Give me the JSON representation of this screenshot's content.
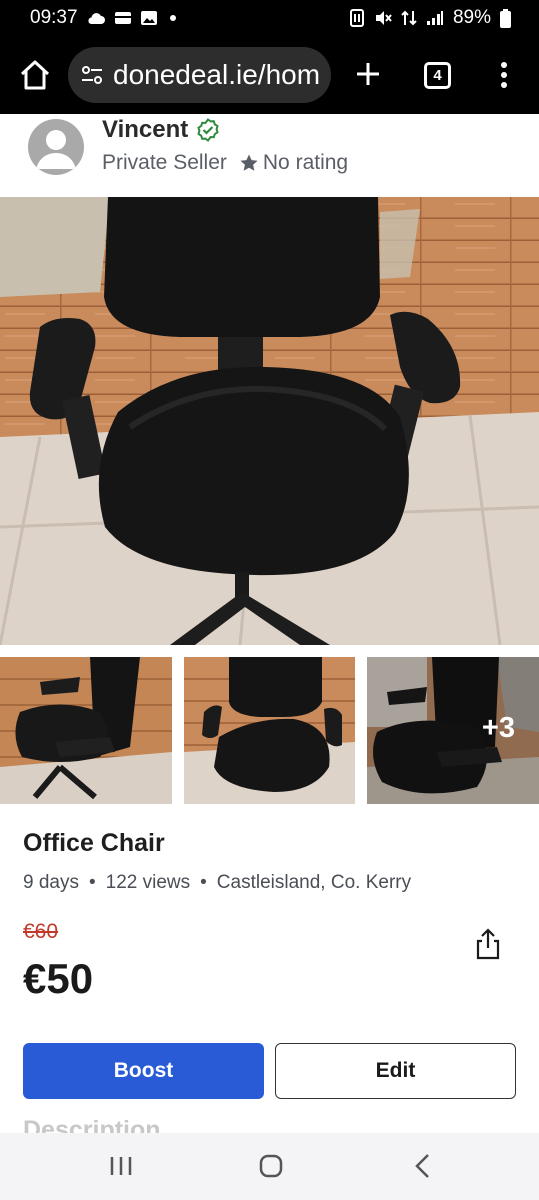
{
  "status_bar": {
    "time": "09:37",
    "battery": "89%"
  },
  "browser": {
    "url": "donedeal.ie/hom",
    "tab_count": "4"
  },
  "seller": {
    "name": "Vincent",
    "type": "Private Seller",
    "rating": "No rating"
  },
  "gallery": {
    "more_label": "+3"
  },
  "listing": {
    "title": "Office Chair",
    "age": "9 days",
    "views": "122 views",
    "location": "Castleisland, Co. Kerry",
    "old_price": "€60",
    "price": "€50"
  },
  "actions": {
    "boost_label": "Boost",
    "edit_label": "Edit"
  },
  "section": {
    "description_label": "Description"
  },
  "colors": {
    "primary_button": "#2a5bd7",
    "verified": "#2e8b3e",
    "old_price": "#c0392b"
  }
}
